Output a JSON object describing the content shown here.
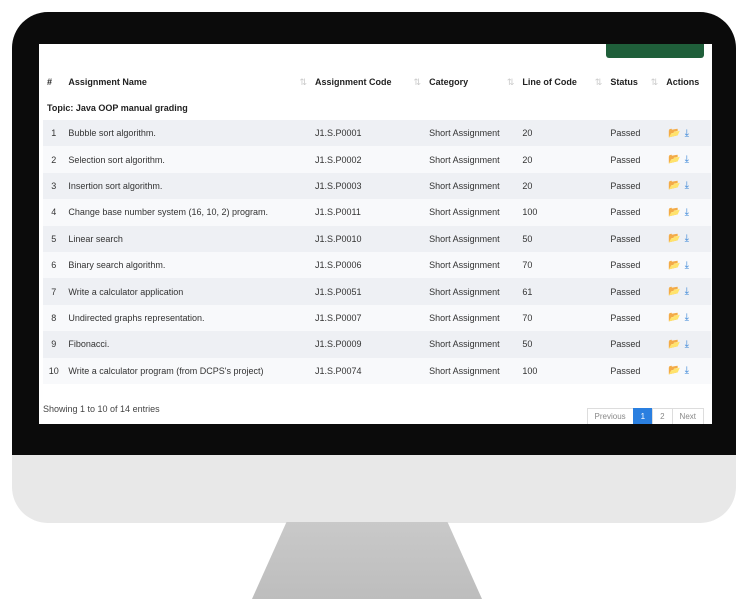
{
  "table": {
    "columns": [
      "#",
      "Assignment Name",
      "Assignment Code",
      "Category",
      "Line of Code",
      "Status",
      "Actions"
    ],
    "topic": "Topic: Java OOP manual grading",
    "rows": [
      {
        "num": "1",
        "name": "Bubble sort algorithm.",
        "code": "J1.S.P0001",
        "category": "Short Assignment",
        "loc": "20",
        "status": "Passed"
      },
      {
        "num": "2",
        "name": "Selection sort algorithm.",
        "code": "J1.S.P0002",
        "category": "Short Assignment",
        "loc": "20",
        "status": "Passed"
      },
      {
        "num": "3",
        "name": "Insertion sort algorithm.",
        "code": "J1.S.P0003",
        "category": "Short Assignment",
        "loc": "20",
        "status": "Passed"
      },
      {
        "num": "4",
        "name": "Change base number system (16, 10, 2) program.",
        "code": "J1.S.P0011",
        "category": "Short Assignment",
        "loc": "100",
        "status": "Passed"
      },
      {
        "num": "5",
        "name": "Linear search",
        "code": "J1.S.P0010",
        "category": "Short Assignment",
        "loc": "50",
        "status": "Passed"
      },
      {
        "num": "6",
        "name": "Binary search algorithm.",
        "code": "J1.S.P0006",
        "category": "Short Assignment",
        "loc": "70",
        "status": "Passed"
      },
      {
        "num": "7",
        "name": "Write a calculator application",
        "code": "J1.S.P0051",
        "category": "Short Assignment",
        "loc": "61",
        "status": "Passed"
      },
      {
        "num": "8",
        "name": "Undirected graphs representation.",
        "code": "J1.S.P0007",
        "category": "Short Assignment",
        "loc": "70",
        "status": "Passed"
      },
      {
        "num": "9",
        "name": "Fibonacci.",
        "code": "J1.S.P0009",
        "category": "Short Assignment",
        "loc": "50",
        "status": "Passed"
      },
      {
        "num": "10",
        "name": "Write a calculator program (from DCPS's project)",
        "code": "J1.S.P0074",
        "category": "Short Assignment",
        "loc": "100",
        "status": "Passed"
      }
    ],
    "action_icons": [
      "folder-open-icon",
      "download-icon"
    ]
  },
  "footer": {
    "showing": "Showing 1 to 10 of 14 entries"
  },
  "pagination": {
    "previous": "Previous",
    "page1": "1",
    "page2": "2",
    "next": "Next"
  },
  "colors": {
    "accent": "#2a7fe0",
    "button_green": "#1f5f3a"
  }
}
